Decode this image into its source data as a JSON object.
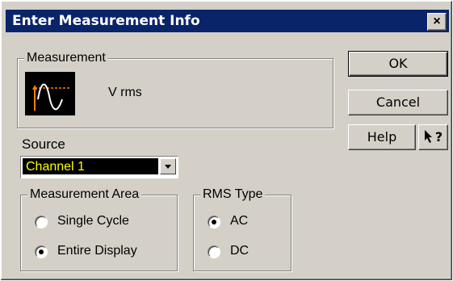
{
  "dialog": {
    "title": "Enter Measurement Info",
    "close_label": "×"
  },
  "measurement": {
    "group_label": "Measurement",
    "icon": "vrms-waveform-icon",
    "name": "V rms"
  },
  "source": {
    "label": "Source",
    "value": "Channel 1"
  },
  "measurement_area": {
    "group_label": "Measurement Area",
    "options": [
      {
        "label": "Single Cycle",
        "checked": false
      },
      {
        "label": "Entire Display",
        "checked": true
      }
    ]
  },
  "rms_type": {
    "group_label": "RMS Type",
    "options": [
      {
        "label": "AC",
        "checked": true
      },
      {
        "label": "DC",
        "checked": false
      }
    ]
  },
  "buttons": {
    "ok": "OK",
    "cancel": "Cancel",
    "help": "Help",
    "context_help": "?"
  },
  "colors": {
    "titlebar": "#0a246a",
    "face": "#d4d0c8",
    "combo_bg": "#000000",
    "combo_text": "#ffff00",
    "icon_trace": "#ffffff",
    "icon_marker": "#ff8000"
  }
}
